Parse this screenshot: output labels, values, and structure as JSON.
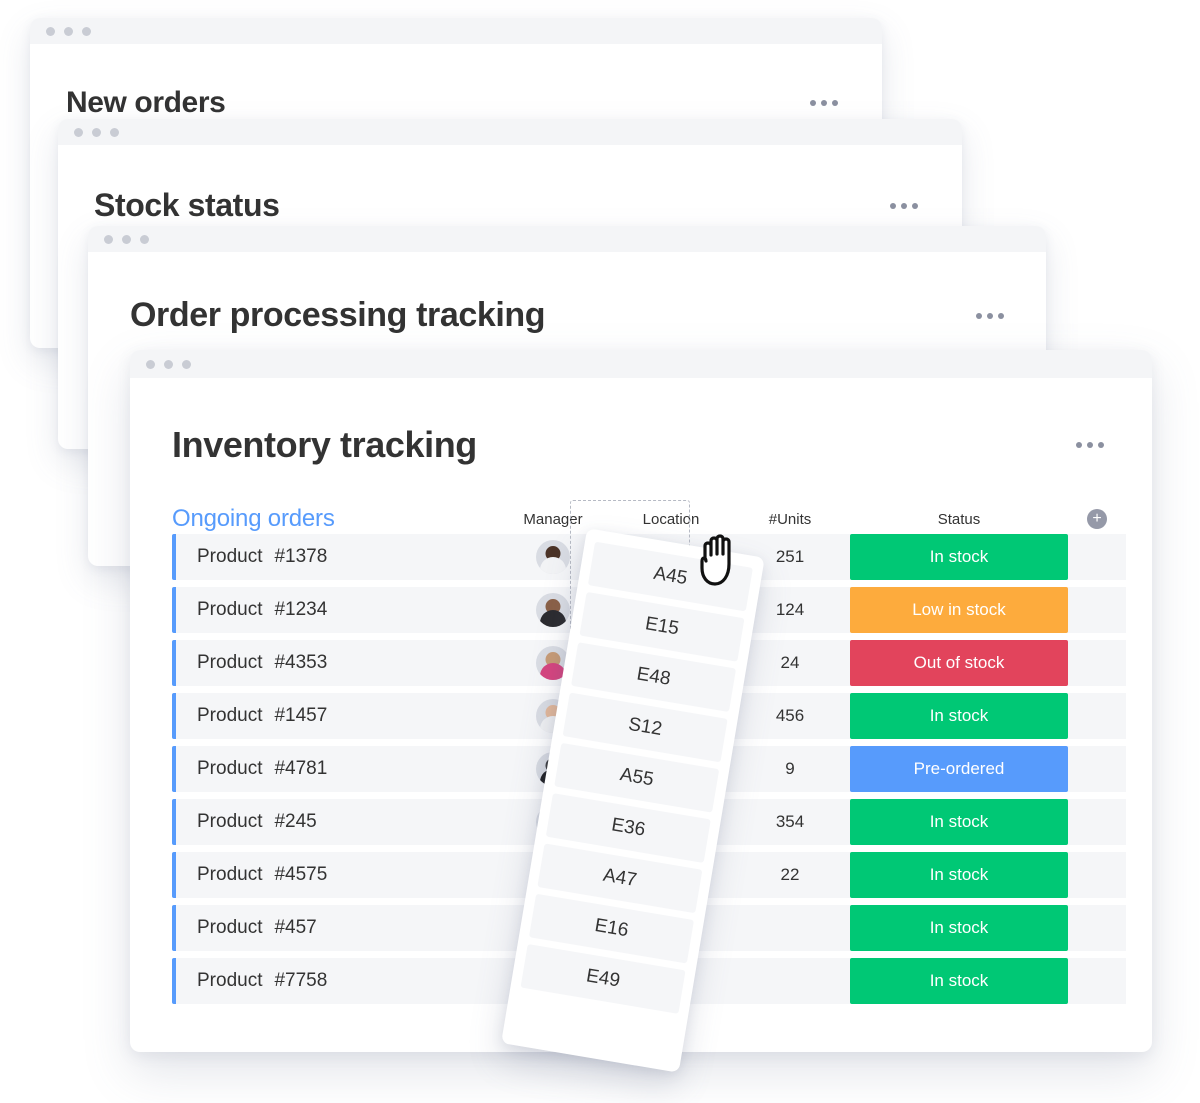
{
  "background_cards": [
    {
      "title": "New orders",
      "menu_icon": "kebab-menu-icon"
    },
    {
      "title": "Stock status",
      "menu_icon": "kebab-menu-icon"
    },
    {
      "title": "Order processing tracking",
      "menu_icon": "kebab-menu-icon"
    }
  ],
  "main_card": {
    "title": "Inventory tracking",
    "menu_icon": "kebab-menu-icon",
    "group_title": "Ongoing orders",
    "columns": {
      "name": "",
      "manager": "Manager",
      "location": "Location",
      "units": "#Units",
      "status": "Status",
      "add": "+"
    },
    "rows": [
      {
        "name_prefix": "Product",
        "name_id": "#1378",
        "units": "251",
        "status": "In stock",
        "status_color": "#00c875"
      },
      {
        "name_prefix": "Product",
        "name_id": "#1234",
        "units": "124",
        "status": "Low in stock",
        "status_color": "#fdab3d"
      },
      {
        "name_prefix": "Product",
        "name_id": "#4353",
        "units": "24",
        "status": "Out of stock",
        "status_color": "#e2445c"
      },
      {
        "name_prefix": "Product",
        "name_id": "#1457",
        "units": "456",
        "status": "In stock",
        "status_color": "#00c875"
      },
      {
        "name_prefix": "Product",
        "name_id": "#4781",
        "units": "9",
        "status": "Pre-ordered",
        "status_color": "#579bfc"
      },
      {
        "name_prefix": "Product",
        "name_id": "#245",
        "units": "354",
        "status": "In stock",
        "status_color": "#00c875"
      },
      {
        "name_prefix": "Product",
        "name_id": "#4575",
        "units": "22",
        "status": "In stock",
        "status_color": "#00c875"
      },
      {
        "name_prefix": "Product",
        "name_id": "#457",
        "units": "",
        "status": "In stock",
        "status_color": "#00c875"
      },
      {
        "name_prefix": "Product",
        "name_id": "#7758",
        "units": "",
        "status": "In stock",
        "status_color": "#00c875"
      }
    ],
    "avatars": [
      {
        "skin": "#4b3327",
        "shirt": "#f2f3f5"
      },
      {
        "skin": "#8a6047",
        "shirt": "#2b2b2f"
      },
      {
        "skin": "#c79b76",
        "shirt": "#d6447f"
      },
      {
        "skin": "#e3b89a",
        "shirt": "#f0f1f3"
      },
      {
        "skin": "#3a3a3c",
        "shirt": "#1d1d20"
      },
      {
        "skin": "#e0b694",
        "shirt": "#4e3427"
      },
      {
        "skin": "#dcae8b",
        "shirt": "#ebecef"
      },
      {
        "skin": "#7a5336",
        "shirt": "#2a2a2e"
      },
      {
        "skin": "#e6c0a2",
        "shirt": "#f2f3f5"
      }
    ]
  },
  "drag_dropdown": {
    "cursor_icon": "grab-hand-cursor",
    "options": [
      "A45",
      "E15",
      "E48",
      "S12",
      "A55",
      "E36",
      "A47",
      "E16",
      "E49"
    ]
  },
  "colors": {
    "accent_blue": "#579bfc",
    "green": "#00c875",
    "orange": "#fdab3d",
    "red": "#e2445c",
    "row_bg": "#f5f6f8",
    "titlebar_bg": "#f4f5f7"
  }
}
